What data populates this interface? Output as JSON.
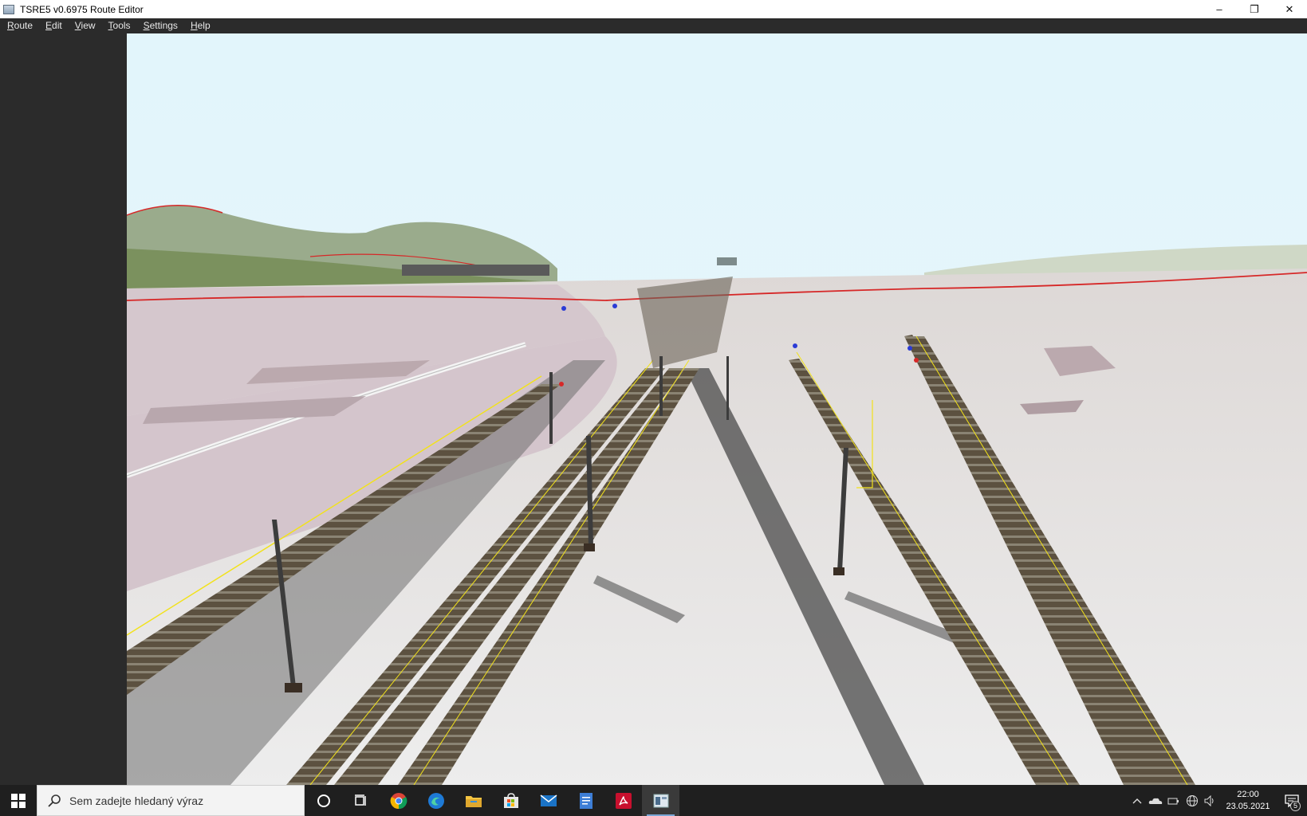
{
  "window": {
    "title": "TSRE5 v0.6975 Route Editor",
    "controls": {
      "minimize": "–",
      "restore": "❐",
      "close": "✕"
    }
  },
  "menu": {
    "items": [
      "Route",
      "Edit",
      "View",
      "Tools",
      "Settings",
      "Help"
    ]
  },
  "viewport": {
    "scene": "3d-route-view",
    "colors": {
      "sky": "#e2f5fb",
      "terrain": "#ece9e7",
      "hills": "#8e9e80",
      "track_ballast": "#5c5140",
      "catenary_wire": "#f2e21a",
      "boundary_line": "#d62828"
    }
  },
  "taskbar": {
    "search_placeholder": "Sem zadejte hledaný výraz",
    "apps": [
      "chrome-icon",
      "edge-icon",
      "file-explorer-icon",
      "store-icon",
      "mail-icon",
      "document-icon",
      "acrobat-icon",
      "route-editor-icon"
    ],
    "tray": {
      "time": "22:00",
      "date": "23.05.2021",
      "notification_count": "5"
    }
  }
}
